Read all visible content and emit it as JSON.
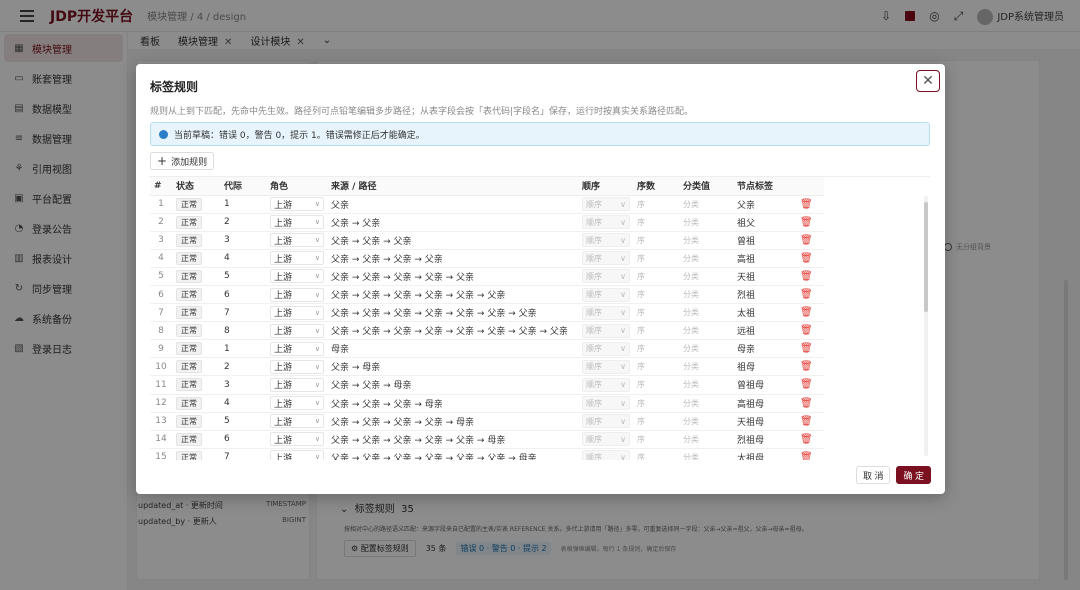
{
  "app": {
    "title": "JDP开发平台",
    "breadcrumb": "模块管理 / 4 / design",
    "user": "JDP系统管理员"
  },
  "sidebar": {
    "items": [
      {
        "label": "模块管理",
        "icon": "grid-icon"
      },
      {
        "label": "账套管理",
        "icon": "folder-icon"
      },
      {
        "label": "数据模型",
        "icon": "model-icon"
      },
      {
        "label": "数据管理",
        "icon": "list-icon"
      },
      {
        "label": "引用视图",
        "icon": "tree-icon"
      },
      {
        "label": "平台配置",
        "icon": "config-icon"
      },
      {
        "label": "登录公告",
        "icon": "bell-icon"
      },
      {
        "label": "报表设计",
        "icon": "report-icon"
      },
      {
        "label": "同步管理",
        "icon": "sync-icon"
      },
      {
        "label": "系统备份",
        "icon": "cloud-icon"
      },
      {
        "label": "登录日志",
        "icon": "log-icon"
      }
    ]
  },
  "tabs": [
    {
      "label": "看板",
      "closable": false
    },
    {
      "label": "模块管理",
      "closable": true
    },
    {
      "label": "设计模块",
      "closable": true
    }
  ],
  "background": {
    "fields": [
      {
        "name": "updated_at · 更新时间",
        "type": "TIMESTAMP"
      },
      {
        "name": "updated_by · 更新人",
        "type": "BIGINT"
      }
    ],
    "section_title": "标签规则",
    "section_count": "35",
    "section_desc": "按相对中心的路径语义匹配：来源字段来自已配置的主表/实表 REFERENCE 关系。多代上游请用「路径」多零，可重复选择同一字段：父亲→父亲=祖父，父亲→母亲=祖母。",
    "config_button": "配置标签规则",
    "count_label": "35 条",
    "status_label": "错误 0 · 警告 0 · 提示 2",
    "hint": "表格弹框编辑，每行 1 条规则，确定后保存",
    "toggle_label": "无分组背景"
  },
  "dialog": {
    "title": "标签规则",
    "description": "规则从上到下匹配，先命中先生效。路径列可点铅笔编辑多步路径；从表字段会按「表代码|字段名」保存，运行时按真实关系路径匹配。",
    "alert": "当前草稿：错误 0，警告 0，提示 1。错误需修正后才能确定。",
    "add_button": "添加规则",
    "columns": [
      "#",
      "状态",
      "代际",
      "角色",
      "来源 / 路径",
      "顺序",
      "序数",
      "分类值",
      "节点标签"
    ],
    "order_placeholder": "顺序",
    "ordinal_placeholder": "序",
    "category_placeholder": "分类",
    "cancel_button": "取 消",
    "ok_button": "确 定",
    "rows": [
      {
        "idx": "1",
        "status": "正常",
        "gen": "1",
        "role": "上游",
        "path": "父亲",
        "label": "父亲"
      },
      {
        "idx": "2",
        "status": "正常",
        "gen": "2",
        "role": "上游",
        "path": "父亲 → 父亲",
        "label": "祖父"
      },
      {
        "idx": "3",
        "status": "正常",
        "gen": "3",
        "role": "上游",
        "path": "父亲 → 父亲 → 父亲",
        "label": "曾祖"
      },
      {
        "idx": "4",
        "status": "正常",
        "gen": "4",
        "role": "上游",
        "path": "父亲 → 父亲 → 父亲 → 父亲",
        "label": "高祖"
      },
      {
        "idx": "5",
        "status": "正常",
        "gen": "5",
        "role": "上游",
        "path": "父亲 → 父亲 → 父亲 → 父亲 → 父亲",
        "label": "天祖"
      },
      {
        "idx": "6",
        "status": "正常",
        "gen": "6",
        "role": "上游",
        "path": "父亲 → 父亲 → 父亲 → 父亲 → 父亲 → 父亲",
        "label": "烈祖"
      },
      {
        "idx": "7",
        "status": "正常",
        "gen": "7",
        "role": "上游",
        "path": "父亲 → 父亲 → 父亲 → 父亲 → 父亲 → 父亲 → 父亲",
        "label": "太祖"
      },
      {
        "idx": "8",
        "status": "正常",
        "gen": "8",
        "role": "上游",
        "path": "父亲 → 父亲 → 父亲 → 父亲 → 父亲 → 父亲 → 父亲 → 父亲",
        "label": "远祖"
      },
      {
        "idx": "9",
        "status": "正常",
        "gen": "1",
        "role": "上游",
        "path": "母亲",
        "label": "母亲"
      },
      {
        "idx": "10",
        "status": "正常",
        "gen": "2",
        "role": "上游",
        "path": "父亲 → 母亲",
        "label": "祖母"
      },
      {
        "idx": "11",
        "status": "正常",
        "gen": "3",
        "role": "上游",
        "path": "父亲 → 父亲 → 母亲",
        "label": "曾祖母"
      },
      {
        "idx": "12",
        "status": "正常",
        "gen": "4",
        "role": "上游",
        "path": "父亲 → 父亲 → 父亲 → 母亲",
        "label": "高祖母"
      },
      {
        "idx": "13",
        "status": "正常",
        "gen": "5",
        "role": "上游",
        "path": "父亲 → 父亲 → 父亲 → 父亲 → 母亲",
        "label": "天祖母"
      },
      {
        "idx": "14",
        "status": "正常",
        "gen": "6",
        "role": "上游",
        "path": "父亲 → 父亲 → 父亲 → 父亲 → 父亲 → 母亲",
        "label": "烈祖母"
      },
      {
        "idx": "15",
        "status": "正常",
        "gen": "7",
        "role": "上游",
        "path": "父亲 → 父亲 → 父亲 → 父亲 → 父亲 → 父亲 → 母亲",
        "label": "太祖母"
      }
    ]
  }
}
